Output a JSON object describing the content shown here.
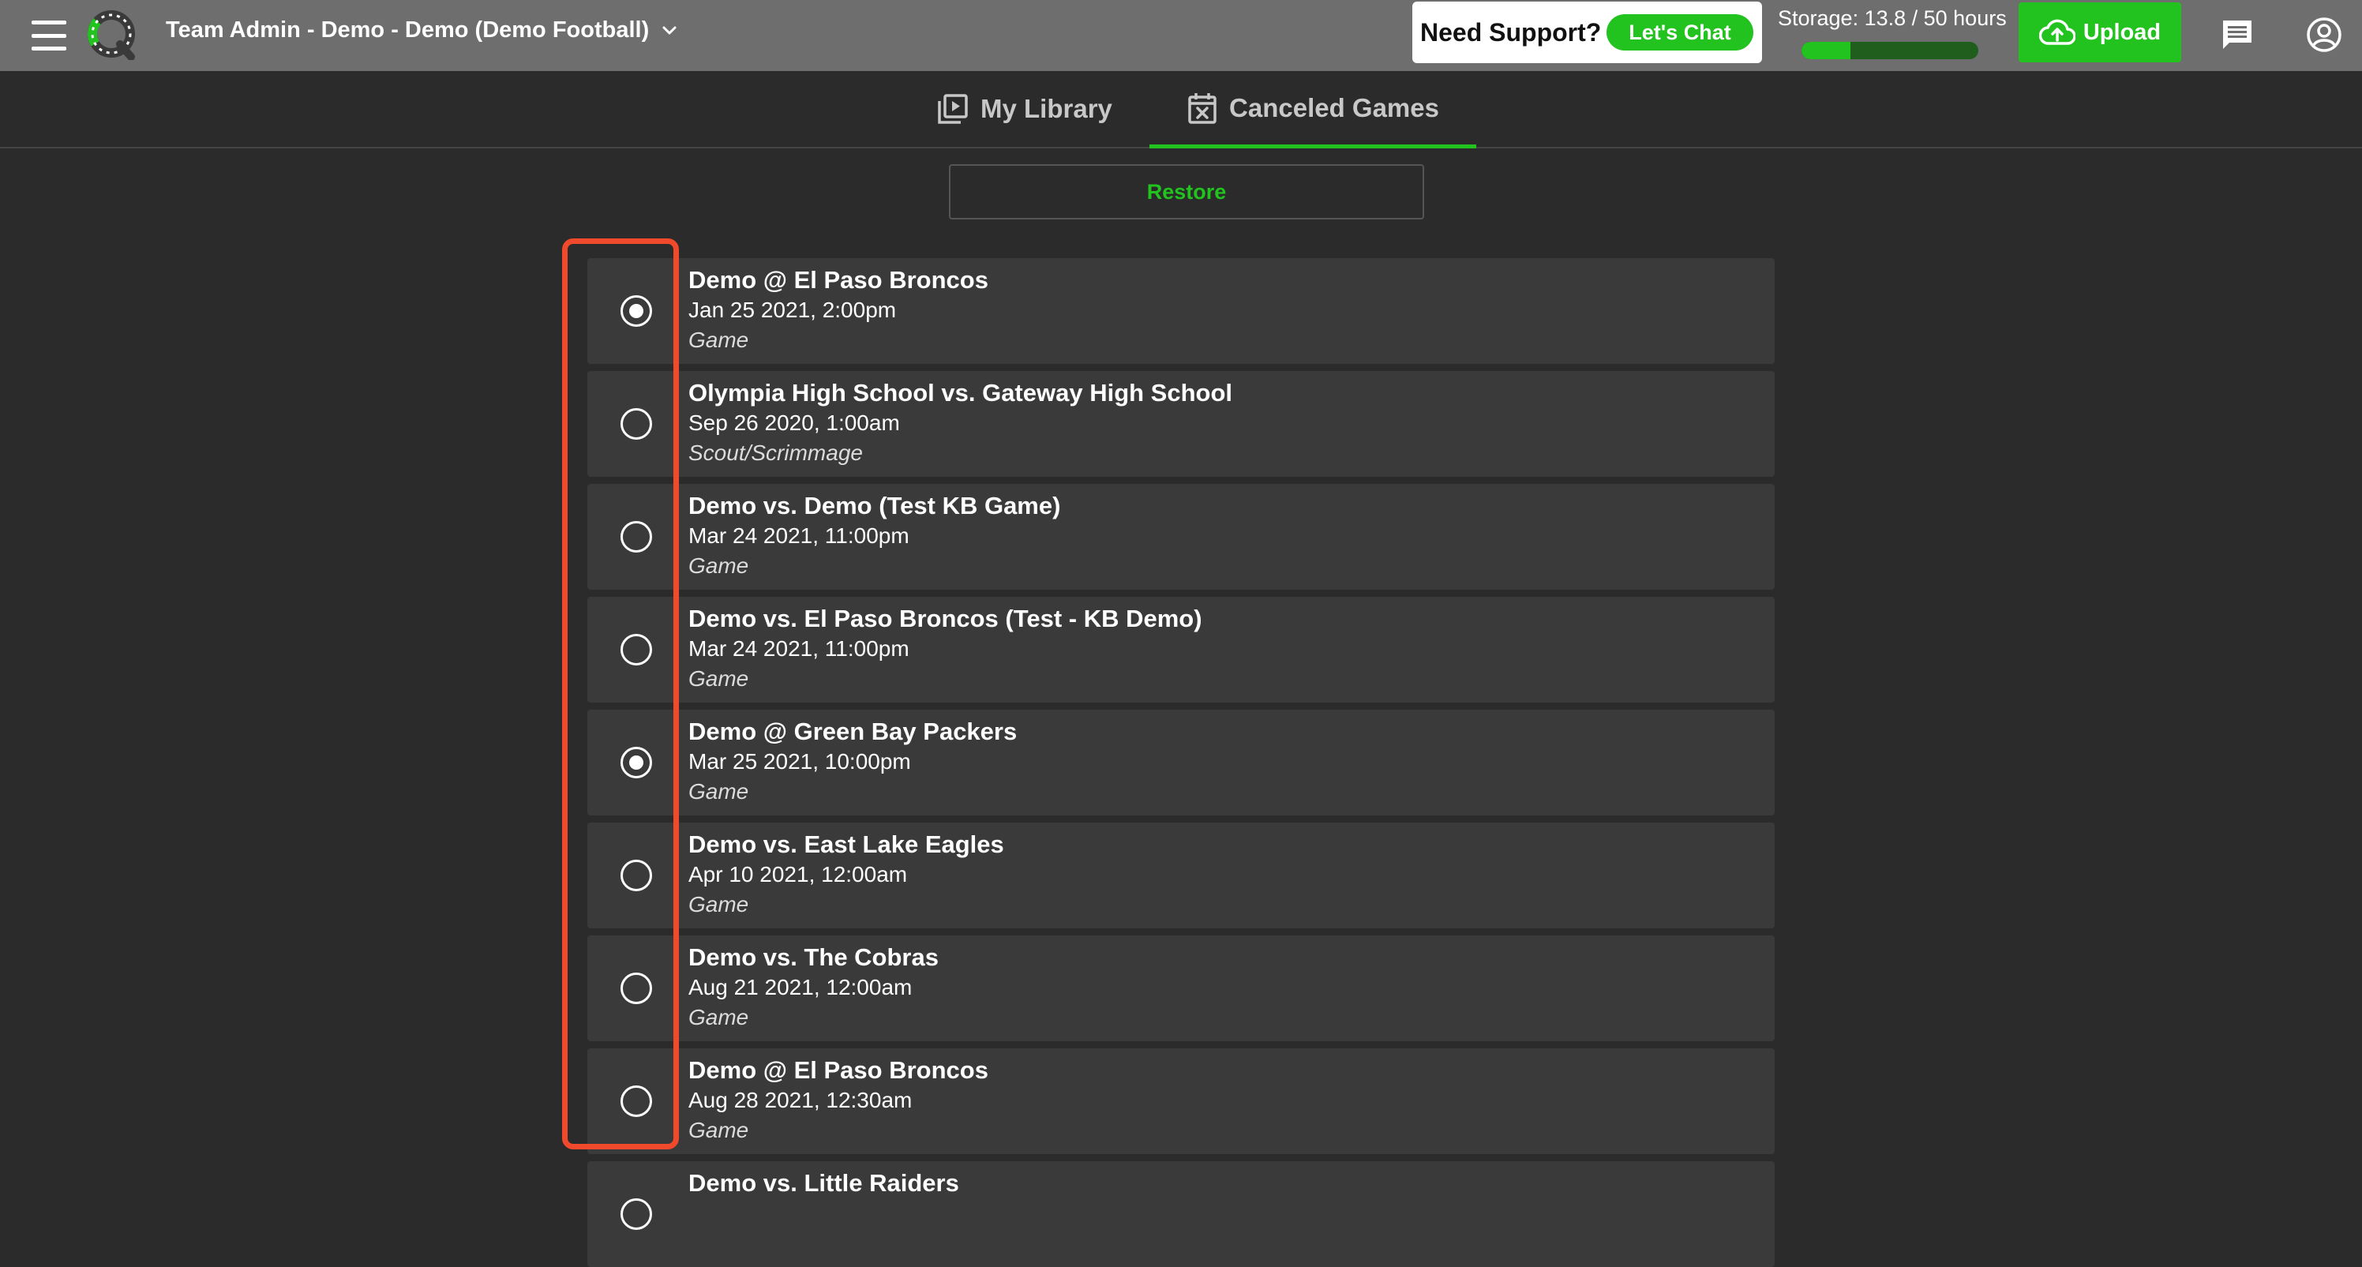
{
  "header": {
    "team_title": "Team Admin - Demo - Demo (Demo Football)",
    "support_text": "Need Support?",
    "chat_label": "Let's Chat",
    "storage_label": "Storage: 13.8 / 50 hours",
    "storage_used_fraction": 0.276,
    "upload_label": "Upload",
    "icons": [
      "hamburger-menu-icon",
      "app-logo",
      "chevron-down-icon",
      "cloud-upload-icon",
      "message-icon",
      "account-circle-icon"
    ]
  },
  "tabs": [
    {
      "label": "My Library",
      "icon": "video-library-icon",
      "active": false
    },
    {
      "label": "Canceled Games",
      "icon": "calendar-x-icon",
      "active": true
    }
  ],
  "restore_label": "Restore",
  "colors": {
    "accent": "#22c21f",
    "topbar": "#6e6e6e",
    "background": "#2b2b2b",
    "row": "#3a3a3a",
    "highlight": "#f0492b"
  },
  "games": [
    {
      "title": "Demo @ El Paso Broncos",
      "date": "Jan 25 2021, 2:00pm",
      "type": "Game",
      "selected": true
    },
    {
      "title": "Olympia High School vs. Gateway High School",
      "date": "Sep 26 2020, 1:00am",
      "type": "Scout/Scrimmage",
      "selected": false
    },
    {
      "title": "Demo vs. Demo (Test KB Game)",
      "date": "Mar 24 2021, 11:00pm",
      "type": "Game",
      "selected": false
    },
    {
      "title": "Demo vs. El Paso Broncos (Test - KB Demo)",
      "date": "Mar 24 2021, 11:00pm",
      "type": "Game",
      "selected": false
    },
    {
      "title": "Demo @ Green Bay Packers",
      "date": "Mar 25 2021, 10:00pm",
      "type": "Game",
      "selected": true
    },
    {
      "title": "Demo vs. East Lake Eagles",
      "date": "Apr 10 2021, 12:00am",
      "type": "Game",
      "selected": false
    },
    {
      "title": "Demo vs. The Cobras",
      "date": "Aug 21 2021, 12:00am",
      "type": "Game",
      "selected": false
    },
    {
      "title": "Demo @ El Paso Broncos",
      "date": "Aug 28 2021, 12:30am",
      "type": "Game",
      "selected": false
    },
    {
      "title": "Demo vs. Little Raiders",
      "date": "",
      "type": "",
      "selected": false
    }
  ]
}
